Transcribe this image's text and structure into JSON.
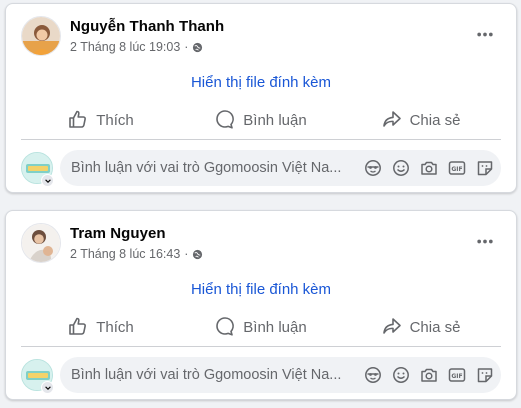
{
  "posts": [
    {
      "author": "Nguyễn Thanh Thanh",
      "date": "2 Tháng 8 lúc 19:03",
      "separator": "·",
      "attachment_link": "Hiển thị file đính kèm",
      "actions": {
        "like": "Thích",
        "comment": "Bình luận",
        "share": "Chia sẻ"
      },
      "comment_placeholder": "Bình luận với vai trò Ggomoosin Việt Na..."
    },
    {
      "author": "Tram Nguyen",
      "date": "2 Tháng 8 lúc 16:43",
      "separator": "·",
      "attachment_link": "Hiển thị file đính kèm",
      "actions": {
        "like": "Thích",
        "comment": "Bình luận",
        "share": "Chia sẻ"
      },
      "comment_placeholder": "Bình luận với vai trò Ggomoosin Việt Na..."
    }
  ],
  "icons": {
    "privacy": "globe-icon",
    "more": "more-options-icon",
    "like": "thumbs-up-icon",
    "comment": "speech-bubble-icon",
    "share": "share-arrow-icon",
    "tools": [
      "avatar-sticker-icon",
      "emoji-icon",
      "camera-icon",
      "gif-icon",
      "sticker-icon"
    ]
  },
  "colors": {
    "link": "#1a57d6",
    "muted_text": "#65676b",
    "page_bg": "#f0f2f5",
    "card_bg": "#ffffff"
  }
}
